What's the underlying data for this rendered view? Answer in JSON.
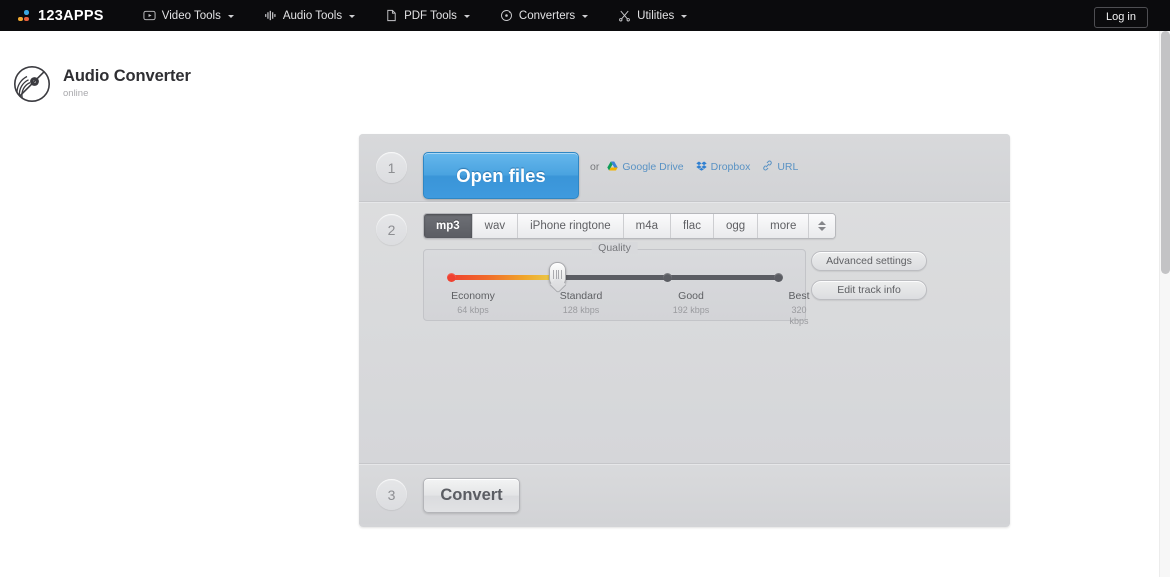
{
  "topbar": {
    "logo_text": "123APPS",
    "nav": [
      {
        "label": "Video Tools",
        "icon": "video-icon",
        "has_caret": true
      },
      {
        "label": "Audio Tools",
        "icon": "waveform-icon",
        "has_caret": true
      },
      {
        "label": "PDF Tools",
        "icon": "document-icon",
        "has_caret": true
      },
      {
        "label": "Converters",
        "icon": "convert-circle-icon",
        "has_caret": true
      },
      {
        "label": "Utilities",
        "icon": "scissors-icon",
        "has_caret": true
      }
    ],
    "login_label": "Log in"
  },
  "app": {
    "title": "Audio Converter",
    "subtitle": "online",
    "icon": "vinyl-record-icon"
  },
  "step1": {
    "number": "1",
    "open_files_label": "Open files",
    "or_label": "or",
    "sources": [
      {
        "label": "Google Drive",
        "icon": "google-drive-icon"
      },
      {
        "label": "Dropbox",
        "icon": "dropbox-icon"
      },
      {
        "label": "URL",
        "icon": "link-icon"
      }
    ]
  },
  "step2": {
    "number": "2",
    "formats": [
      {
        "label": "mp3",
        "active": true
      },
      {
        "label": "wav",
        "active": false
      },
      {
        "label": "iPhone ringtone",
        "active": false
      },
      {
        "label": "m4a",
        "active": false
      },
      {
        "label": "flac",
        "active": false
      },
      {
        "label": "ogg",
        "active": false
      },
      {
        "label": "more",
        "active": false
      }
    ],
    "spinner_icon": "spinner-up-down-icon",
    "quality": {
      "legend": "Quality",
      "selected_index": 1,
      "stops": [
        {
          "name": "Economy",
          "rate": "64 kbps",
          "pos_pct": 0
        },
        {
          "name": "Standard",
          "rate": "128 kbps",
          "pos_pct": 33.3
        },
        {
          "name": "Good",
          "rate": "192 kbps",
          "pos_pct": 66.6
        },
        {
          "name": "Best",
          "rate": "320 kbps",
          "pos_pct": 100
        }
      ]
    },
    "advanced_settings_label": "Advanced settings",
    "edit_track_info_label": "Edit track info"
  },
  "step3": {
    "number": "3",
    "convert_label": "Convert"
  },
  "colors": {
    "accent_blue": "#4aa3e0",
    "link_blue": "#5a92c4",
    "tab_active_bg": "#5b5d63",
    "quality_low": "#ef4130",
    "quality_mid": "#f0a62a",
    "track_dark": "#5b5d63",
    "card_bg": "#d5d6d9",
    "topbar_bg": "#0b0b0d"
  }
}
